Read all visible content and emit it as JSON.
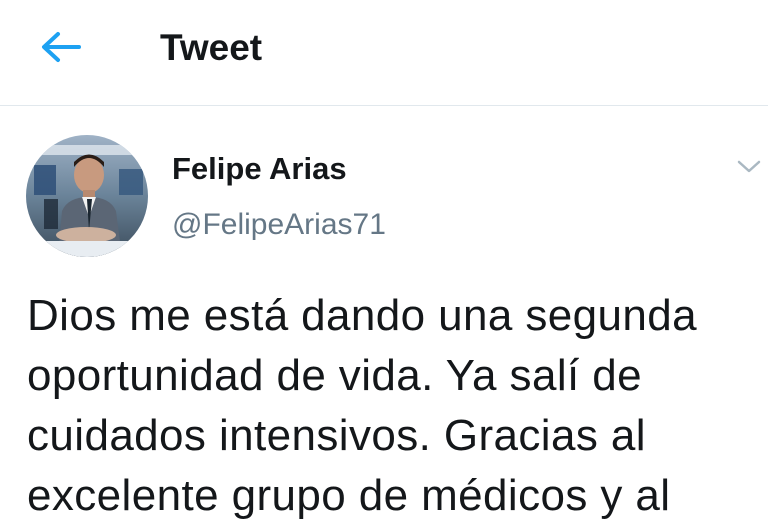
{
  "header": {
    "title": "Tweet",
    "back_icon": "arrow-left-icon",
    "accent_color": "#1da1f2"
  },
  "tweet": {
    "author": {
      "name": "Felipe Arias",
      "handle": "@FelipeArias71",
      "avatar": "profile-photo"
    },
    "menu_icon": "chevron-down-icon",
    "text": "Dios me está dando una segunda\noportunidad de vida. Ya salí de\ncuidados intensivos. Gracias al\nexcelente grupo de médicos y al"
  }
}
